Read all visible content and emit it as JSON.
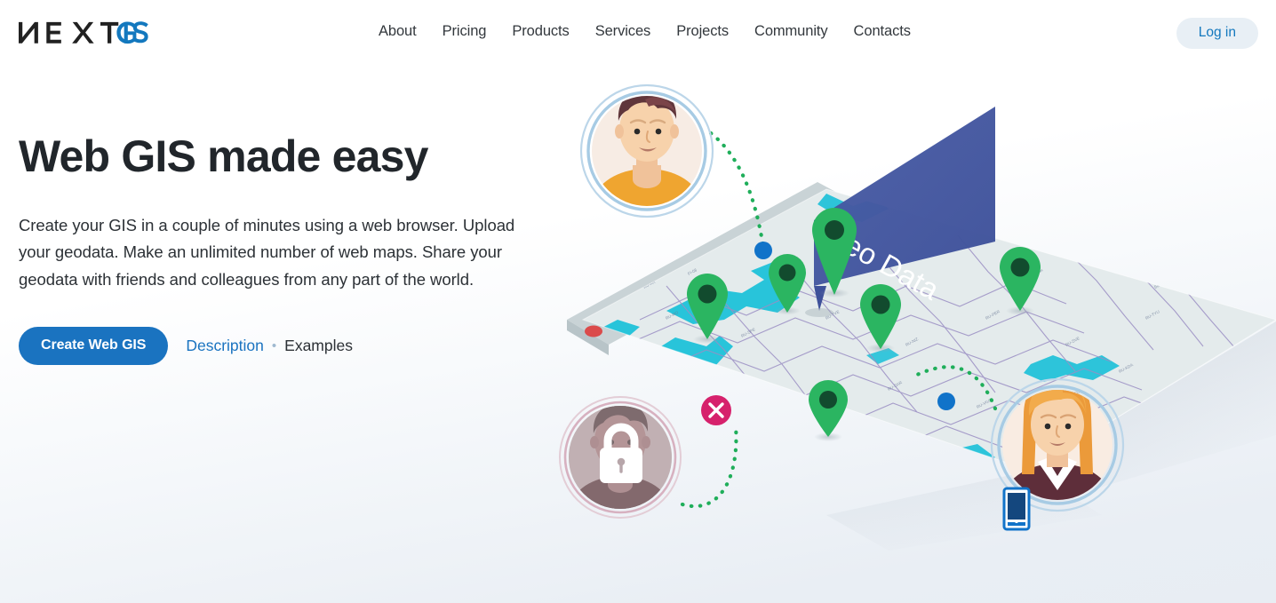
{
  "brand": {
    "logo_text_dark": "NƎXT",
    "logo_text_blue": "GIS",
    "logo_name": "NEXTGIS",
    "color_dark": "#212121",
    "color_blue": "#1378be"
  },
  "header": {
    "nav": [
      {
        "label": "About",
        "name": "nav-about"
      },
      {
        "label": "Pricing",
        "name": "nav-pricing"
      },
      {
        "label": "Products",
        "name": "nav-products"
      },
      {
        "label": "Services",
        "name": "nav-services"
      },
      {
        "label": "Projects",
        "name": "nav-projects"
      },
      {
        "label": "Community",
        "name": "nav-community"
      },
      {
        "label": "Contacts",
        "name": "nav-contacts"
      }
    ],
    "login_label": "Log in",
    "login_bg": "#e8eff5",
    "login_color": "#1378be"
  },
  "hero": {
    "title": "Web GIS made easy",
    "paragraph": "Create your GIS in a couple of minutes using a web browser. Upload your geodata. Make an unlimited number of web maps. Share your geodata with friends and colleagues from any part of the world.",
    "cta_primary": "Create Web GIS",
    "link_description": "Examples",
    "link_desc_label": "Description",
    "separator": "•",
    "link_examples_label": "Examples",
    "primary_color": "#1a73c0",
    "text_color": "#21262b"
  },
  "illustration": {
    "banner_label": "Geo Data",
    "banner_color": "#44589e",
    "map": {
      "surface_color": "#e4ebec",
      "water_color": "#18c0d8",
      "border_color": "#9b8fc4",
      "pin_color": "#2bb561",
      "pin_core_color": "#124b2e",
      "node_color": "#1173c9",
      "pin_count": 6,
      "node_count": 3
    },
    "browser_dots": [
      "#db4b4b",
      "#f2cf2c",
      "#2bb561"
    ],
    "avatars": [
      {
        "name": "avatar-top-user",
        "ring_color": "#a7cbe4",
        "state": "active"
      },
      {
        "name": "avatar-locked-user",
        "ring_color": "#d7b1c0",
        "state": "locked",
        "badge": "lock-icon"
      },
      {
        "name": "avatar-mobile-user",
        "ring_color": "#a7cbe4",
        "state": "mobile",
        "badge": "mobile-phone-icon"
      }
    ],
    "badges": [
      {
        "name": "error-badge",
        "glyph": "✕",
        "color": "#d6216c"
      }
    ],
    "connector_color": "#1fae5a"
  }
}
